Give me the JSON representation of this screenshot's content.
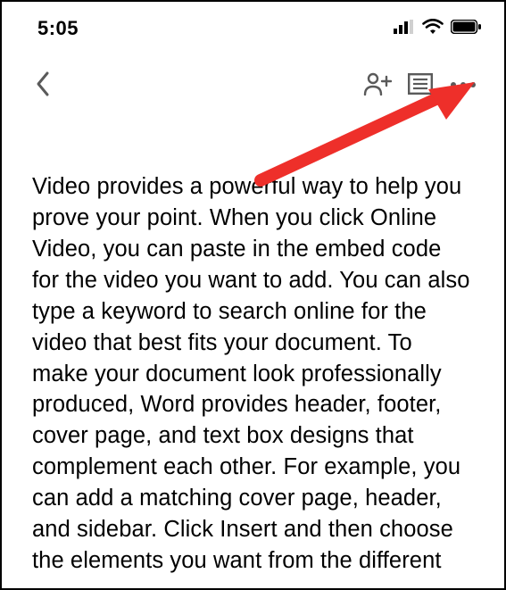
{
  "status": {
    "time": "5:05"
  },
  "document": {
    "body": "Video provides a powerful way to help you prove your point. When you click Online Video, you can paste in the embed code for the video you want to add. You can also type a keyword to search online for the video that best fits your document. To make your document look professionally produced, Word provides header, footer, cover page, and text box designs that complement each other. For example, you can add a matching cover page, header, and sidebar. Click Insert and then choose the elements you want from the different"
  }
}
